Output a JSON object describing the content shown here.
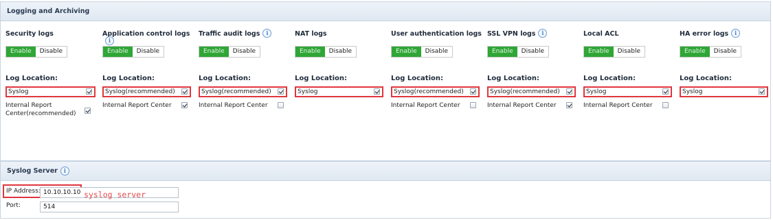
{
  "logging": {
    "title": "Logging and Archiving",
    "enable_label": "Enable",
    "disable_label": "Disable",
    "location_label": "Log Location:",
    "columns": [
      {
        "title": "Security logs",
        "has_info": false,
        "options": [
          {
            "label": "Syslog",
            "checked": true
          },
          {
            "label": "Internal Report Center(recommended)",
            "checked": true
          }
        ]
      },
      {
        "title": "Application control logs",
        "has_info": true,
        "options": [
          {
            "label": "Syslog(recommended)",
            "checked": true
          },
          {
            "label": "Internal Report Center",
            "checked": true
          }
        ]
      },
      {
        "title": "Traffic audit logs",
        "has_info": true,
        "options": [
          {
            "label": "Syslog(recommended)",
            "checked": true
          },
          {
            "label": "Internal Report Center",
            "checked": false
          }
        ]
      },
      {
        "title": "NAT logs",
        "has_info": false,
        "options": [
          {
            "label": "Syslog",
            "checked": true
          }
        ]
      },
      {
        "title": "User authentication logs",
        "has_info": false,
        "options": [
          {
            "label": "Syslog(recommended)",
            "checked": true
          },
          {
            "label": "Internal Report Center",
            "checked": false
          }
        ]
      },
      {
        "title": "SSL VPN logs",
        "has_info": true,
        "options": [
          {
            "label": "Syslog(recommended)",
            "checked": true
          },
          {
            "label": "Internal Report Center",
            "checked": true
          }
        ]
      },
      {
        "title": "Local ACL",
        "has_info": false,
        "options": [
          {
            "label": "Syslog",
            "checked": true
          },
          {
            "label": "Internal Report Center",
            "checked": false
          }
        ]
      },
      {
        "title": "HA error logs",
        "has_info": true,
        "options": [
          {
            "label": "Syslog",
            "checked": true
          }
        ]
      }
    ]
  },
  "syslog_server": {
    "title": "Syslog Server",
    "ip_label": "IP Address:",
    "ip_value": "10.10.10.10",
    "port_label": "Port:",
    "port_value": "514",
    "annotation": "syslog server"
  },
  "colors": {
    "enable": "#2fa636",
    "highlight": "#e0353d",
    "annotation": "#e34b4b"
  },
  "icons": {
    "info": "info-circle-icon",
    "check": "checkbox-icon"
  }
}
